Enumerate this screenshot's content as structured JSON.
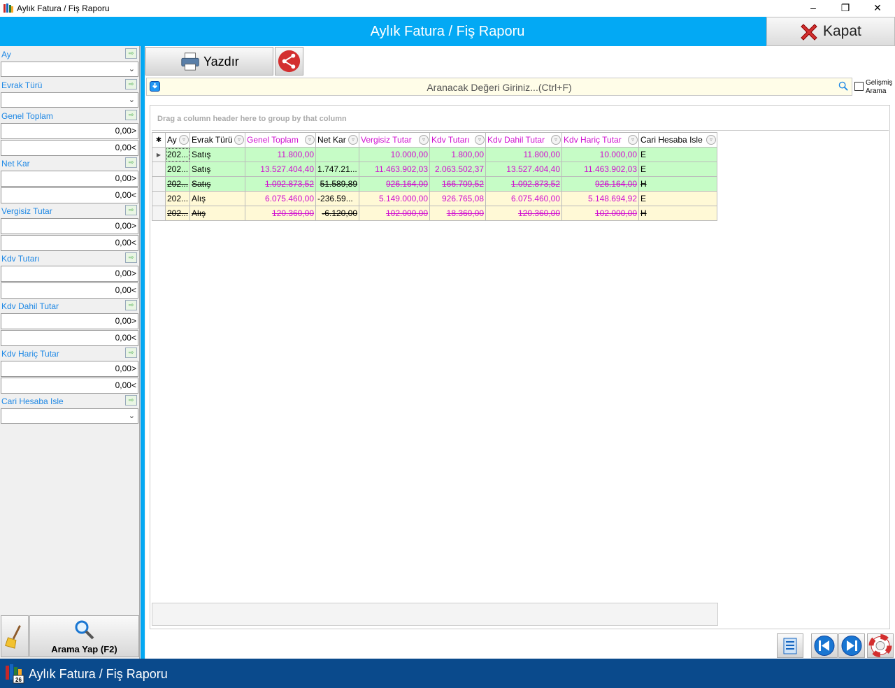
{
  "window": {
    "title": "Aylık Fatura / Fiş Raporu",
    "minimize": "–",
    "restore": "❐",
    "close": "✕"
  },
  "header": {
    "title": "Aylık Fatura / Fiş Raporu",
    "close_label": "Kapat"
  },
  "filters": {
    "ay": {
      "label": "Ay",
      "value": ""
    },
    "evrak_turu": {
      "label": "Evrak Türü",
      "value": ""
    },
    "genel_toplam": {
      "label": "Genel Toplam",
      "min": "0,00>",
      "max": "0,00<"
    },
    "net_kar": {
      "label": "Net Kar",
      "min": "0,00>",
      "max": "0,00<"
    },
    "vergisiz_tutar": {
      "label": "Vergisiz Tutar",
      "min": "0,00>",
      "max": "0,00<"
    },
    "kdv_tutari": {
      "label": "Kdv Tutarı",
      "min": "0,00>",
      "max": "0,00<"
    },
    "kdv_dahil_tutar": {
      "label": "Kdv Dahil Tutar",
      "min": "0,00>",
      "max": "0,00<"
    },
    "kdv_haric_tutar": {
      "label": "Kdv Hariç Tutar",
      "min": "0,00>",
      "max": "0,00<"
    },
    "cari_hesaba_isle": {
      "label": "Cari Hesaba Isle",
      "value": ""
    },
    "search_button": "Arama Yap (F2)"
  },
  "toolbar": {
    "print_label": "Yazdır"
  },
  "search": {
    "placeholder": "Aranacak Değeri Giriniz...(Ctrl+F)",
    "advanced_label": "Gelişmiş Arama"
  },
  "grid": {
    "group_hint": "Drag a column header here to group by that column",
    "columns": [
      "Ay",
      "Evrak Türü",
      "Genel Toplam",
      "Net Kar",
      "Vergisiz Tutar",
      "Kdv Tutarı",
      "Kdv Dahil Tutar",
      "Kdv Hariç Tutar",
      "Cari Hesaba Isle"
    ],
    "rows": [
      {
        "ay": "202...",
        "evrak": "Satış",
        "genel": "11.800,00",
        "netkar": "",
        "vergisiz": "10.000,00",
        "kdv": "1.800,00",
        "dahil": "11.800,00",
        "haric": "10.000,00",
        "cari": "E"
      },
      {
        "ay": "202...",
        "evrak": "Satış",
        "genel": "13.527.404,40",
        "netkar": "1.747.21...",
        "vergisiz": "11.463.902,03",
        "kdv": "2.063.502,37",
        "dahil": "13.527.404,40",
        "haric": "11.463.902,03",
        "cari": "E"
      },
      {
        "ay": "202...",
        "evrak": "Satış",
        "genel": "1.092.873,52",
        "netkar": "51.589,89",
        "vergisiz": "926.164,00",
        "kdv": "166.709,52",
        "dahil": "1.092.873,52",
        "haric": "926.164,00",
        "cari": "H"
      },
      {
        "ay": "202...",
        "evrak": "Alış",
        "genel": "6.075.460,00",
        "netkar": "-236.59...",
        "vergisiz": "5.149.000,00",
        "kdv": "926.765,08",
        "dahil": "6.075.460,00",
        "haric": "5.148.694,92",
        "cari": "E"
      },
      {
        "ay": "202...",
        "evrak": "Alış",
        "genel": "120.360,00",
        "netkar": "-6.120,00",
        "vergisiz": "102.000,00",
        "kdv": "18.360,00",
        "dahil": "120.360,00",
        "haric": "102.000,00",
        "cari": "H"
      }
    ]
  },
  "taskbar": {
    "title": "Aylık Fatura / Fiş Raporu",
    "badge": "26"
  },
  "colors": {
    "accent": "#03a9f4",
    "taskbar": "#0a4a8c",
    "magenta": "#d010d0",
    "green_row": "#c6fcc6",
    "yellow_row": "#fff9d6"
  }
}
